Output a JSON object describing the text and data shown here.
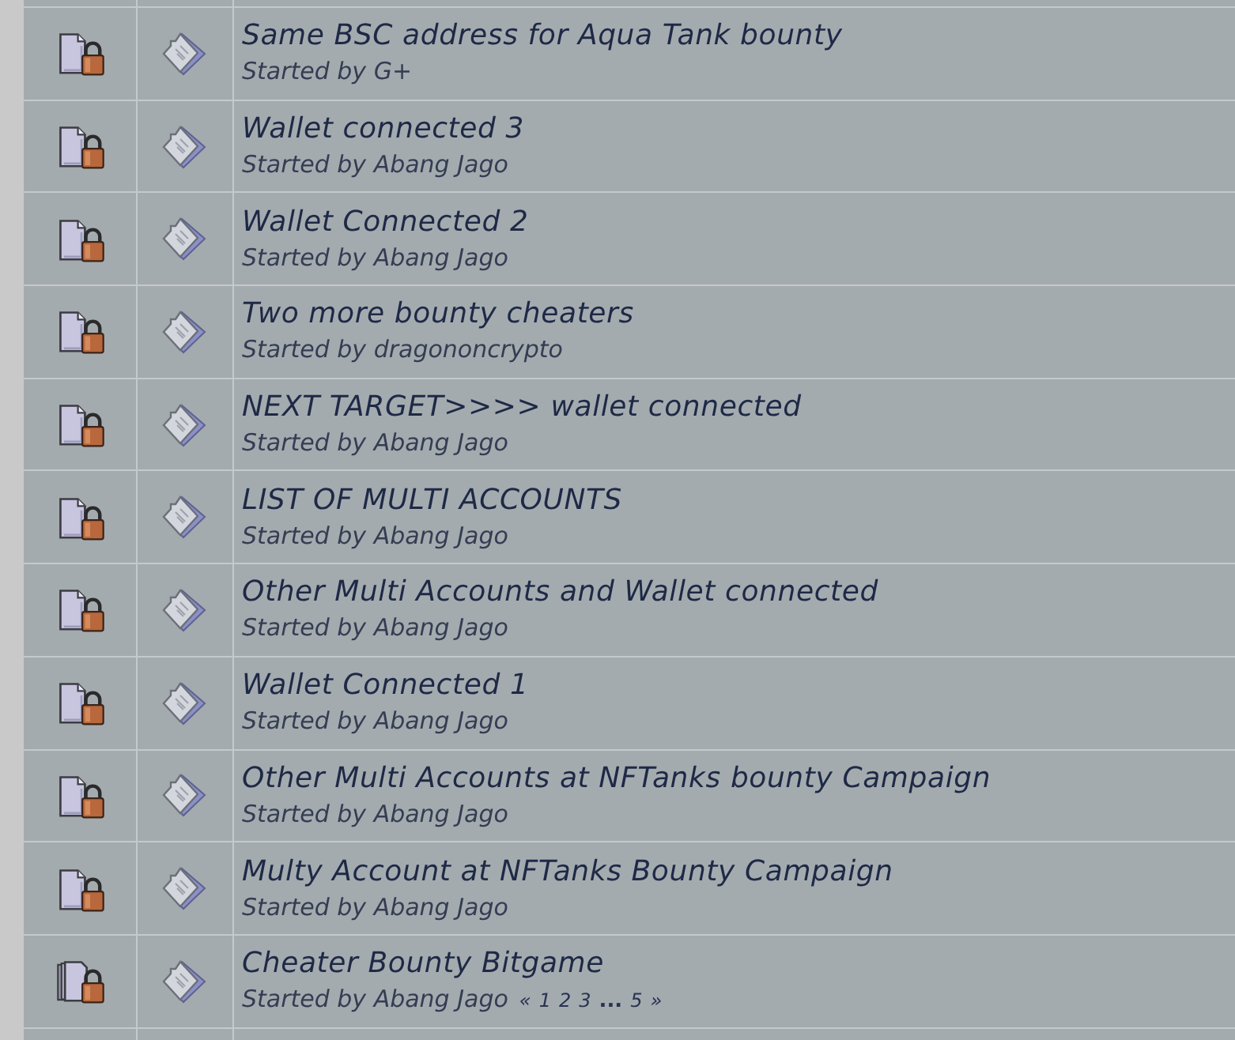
{
  "topics": [
    {
      "kind": "locked",
      "title": "Same BSC address for Aqua Tank bounty",
      "starter": "Started by G+"
    },
    {
      "kind": "locked",
      "title": "Wallet connected 3",
      "starter": "Started by Abang Jago"
    },
    {
      "kind": "locked",
      "title": "Wallet Connected 2",
      "starter": "Started by Abang Jago"
    },
    {
      "kind": "locked",
      "title": "Two more bounty cheaters",
      "starter": "Started by dragononcrypto"
    },
    {
      "kind": "locked",
      "title": "NEXT TARGET>>>> wallet connected",
      "starter": "Started by Abang Jago"
    },
    {
      "kind": "locked",
      "title": "LIST OF MULTI ACCOUNTS",
      "starter": "Started by Abang Jago"
    },
    {
      "kind": "locked",
      "title": "Other Multi Accounts and Wallet connected",
      "starter": "Started by Abang Jago"
    },
    {
      "kind": "locked",
      "title": "Wallet Connected 1",
      "starter": "Started by Abang Jago"
    },
    {
      "kind": "locked",
      "title": "Other Multi Accounts at NFTanks bounty Campaign",
      "starter": "Started by Abang Jago"
    },
    {
      "kind": "locked",
      "title": "Multy Account at NFTanks Bounty Campaign",
      "starter": "Started by Abang Jago"
    },
    {
      "kind": "locked-multi",
      "title": "Cheater Bounty Bitgame",
      "starter": "Started by Abang Jago",
      "pages": [
        {
          "kind": "link",
          "label": "«"
        },
        {
          "kind": "link",
          "label": "1"
        },
        {
          "kind": "link",
          "label": "2"
        },
        {
          "kind": "link",
          "label": "3"
        },
        {
          "kind": "gap",
          "label": "..."
        },
        {
          "kind": "link",
          "label": "5"
        },
        {
          "kind": "link",
          "label": "»"
        }
      ]
    }
  ]
}
